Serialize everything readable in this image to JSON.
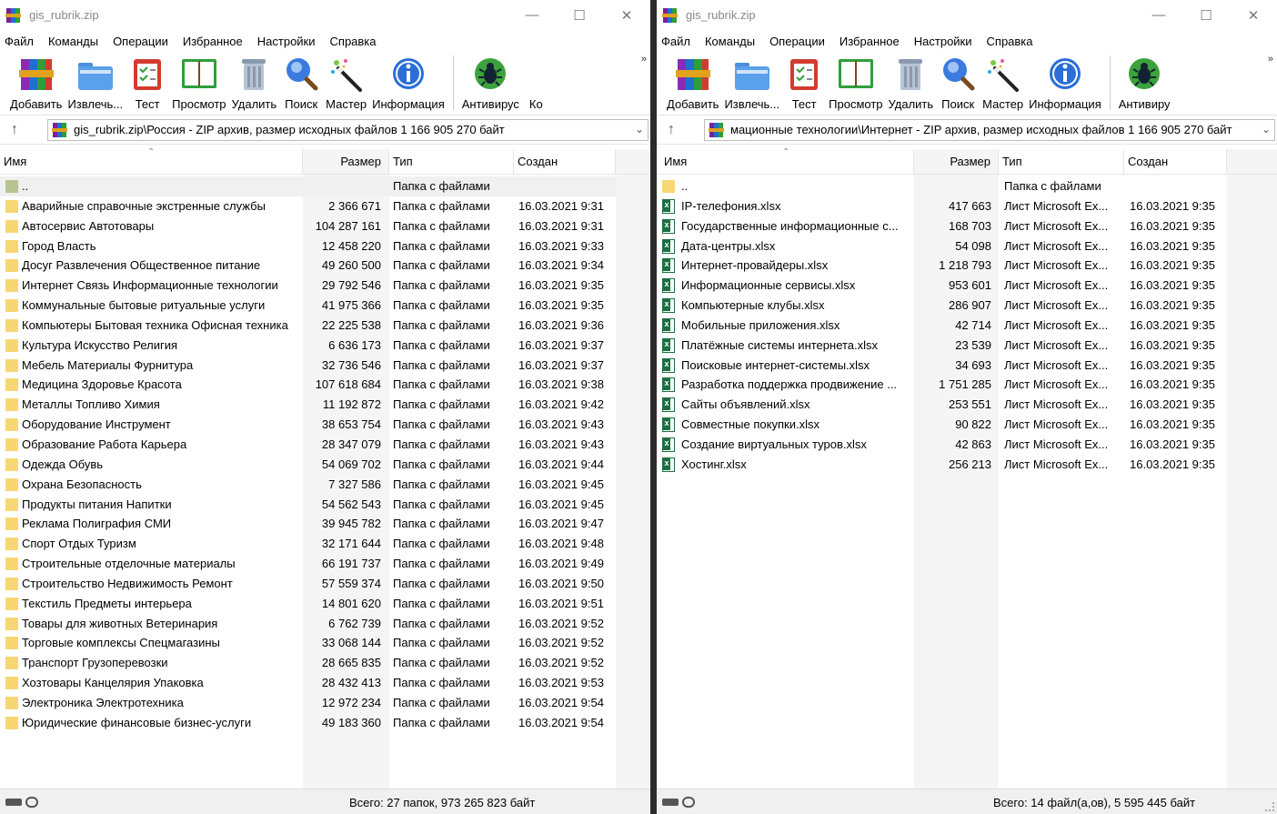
{
  "colors": {
    "folder": "#f7d774",
    "excel": "#1d6f42",
    "accent": "#0a5bd6"
  },
  "left": {
    "title": "gis_rubrik.zip",
    "menu": [
      "Файл",
      "Команды",
      "Операции",
      "Избранное",
      "Настройки",
      "Справка"
    ],
    "toolbar": [
      {
        "label": "Добавить",
        "icon": "books-icon"
      },
      {
        "label": "Извлечь...",
        "icon": "folder-extract-icon"
      },
      {
        "label": "Тест",
        "icon": "test-clipboard-icon"
      },
      {
        "label": "Просмотр",
        "icon": "book-view-icon"
      },
      {
        "label": "Удалить",
        "icon": "trash-icon"
      },
      {
        "label": "Поиск",
        "icon": "magnifier-icon"
      },
      {
        "label": "Мастер",
        "icon": "wand-icon"
      },
      {
        "label": "Информация",
        "icon": "info-icon"
      },
      {
        "label": "Антивирус",
        "icon": "bug-icon"
      },
      {
        "label": "Ко",
        "icon": ""
      }
    ],
    "address": "gis_rubrik.zip\\Россия - ZIP архив, размер исходных файлов 1 166 905 270 байт",
    "columns": {
      "name": "Имя",
      "size": "Размер",
      "type": "Тип",
      "created": "Создан"
    },
    "parent": {
      "name": "..",
      "type": "Папка с файлами"
    },
    "rows": [
      {
        "name": "Аварийные справочные экстренные службы",
        "size": "2 366 671",
        "type": "Папка с файлами",
        "created": "16.03.2021 9:31"
      },
      {
        "name": "Автосервис Автотовары",
        "size": "104 287 161",
        "type": "Папка с файлами",
        "created": "16.03.2021 9:31"
      },
      {
        "name": "Город Власть",
        "size": "12 458 220",
        "type": "Папка с файлами",
        "created": "16.03.2021 9:33"
      },
      {
        "name": "Досуг Развлечения Общественное питание",
        "size": "49 260 500",
        "type": "Папка с файлами",
        "created": "16.03.2021 9:34"
      },
      {
        "name": "Интернет Связь Информационные технологии",
        "size": "29 792 546",
        "type": "Папка с файлами",
        "created": "16.03.2021 9:35"
      },
      {
        "name": "Коммунальные бытовые ритуальные услуги",
        "size": "41 975 366",
        "type": "Папка с файлами",
        "created": "16.03.2021 9:35"
      },
      {
        "name": "Компьютеры Бытовая техника Офисная техника",
        "size": "22 225 538",
        "type": "Папка с файлами",
        "created": "16.03.2021 9:36"
      },
      {
        "name": "Культура Искусство Религия",
        "size": "6 636 173",
        "type": "Папка с файлами",
        "created": "16.03.2021 9:37"
      },
      {
        "name": "Мебель Материалы Фурнитура",
        "size": "32 736 546",
        "type": "Папка с файлами",
        "created": "16.03.2021 9:37"
      },
      {
        "name": "Медицина Здоровье Красота",
        "size": "107 618 684",
        "type": "Папка с файлами",
        "created": "16.03.2021 9:38"
      },
      {
        "name": "Металлы Топливо Химия",
        "size": "11 192 872",
        "type": "Папка с файлами",
        "created": "16.03.2021 9:42"
      },
      {
        "name": "Оборудование Инструмент",
        "size": "38 653 754",
        "type": "Папка с файлами",
        "created": "16.03.2021 9:43"
      },
      {
        "name": "Образование Работа Карьера",
        "size": "28 347 079",
        "type": "Папка с файлами",
        "created": "16.03.2021 9:43"
      },
      {
        "name": "Одежда Обувь",
        "size": "54 069 702",
        "type": "Папка с файлами",
        "created": "16.03.2021 9:44"
      },
      {
        "name": "Охрана Безопасность",
        "size": "7 327 586",
        "type": "Папка с файлами",
        "created": "16.03.2021 9:45"
      },
      {
        "name": "Продукты питания Напитки",
        "size": "54 562 543",
        "type": "Папка с файлами",
        "created": "16.03.2021 9:45"
      },
      {
        "name": "Реклама Полиграфия СМИ",
        "size": "39 945 782",
        "type": "Папка с файлами",
        "created": "16.03.2021 9:47"
      },
      {
        "name": "Спорт Отдых Туризм",
        "size": "32 171 644",
        "type": "Папка с файлами",
        "created": "16.03.2021 9:48"
      },
      {
        "name": "Строительные отделочные материалы",
        "size": "66 191 737",
        "type": "Папка с файлами",
        "created": "16.03.2021 9:49"
      },
      {
        "name": "Строительство Недвижимость Ремонт",
        "size": "57 559 374",
        "type": "Папка с файлами",
        "created": "16.03.2021 9:50"
      },
      {
        "name": "Текстиль Предметы интерьера",
        "size": "14 801 620",
        "type": "Папка с файлами",
        "created": "16.03.2021 9:51"
      },
      {
        "name": "Товары для животных Ветеринария",
        "size": "6 762 739",
        "type": "Папка с файлами",
        "created": "16.03.2021 9:52"
      },
      {
        "name": "Торговые комплексы Спецмагазины",
        "size": "33 068 144",
        "type": "Папка с файлами",
        "created": "16.03.2021 9:52"
      },
      {
        "name": "Транспорт Грузоперевозки",
        "size": "28 665 835",
        "type": "Папка с файлами",
        "created": "16.03.2021 9:52"
      },
      {
        "name": "Хозтовары Канцелярия Упаковка",
        "size": "28 432 413",
        "type": "Папка с файлами",
        "created": "16.03.2021 9:53"
      },
      {
        "name": "Электроника Электротехника",
        "size": "12 972 234",
        "type": "Папка с файлами",
        "created": "16.03.2021 9:54"
      },
      {
        "name": "Юридические финансовые бизнес-услуги",
        "size": "49 183 360",
        "type": "Папка с файлами",
        "created": "16.03.2021 9:54"
      }
    ],
    "status": "Всего: 27 папок, 973 265 823 байт"
  },
  "right": {
    "title": "gis_rubrik.zip",
    "menu": [
      "Файл",
      "Команды",
      "Операции",
      "Избранное",
      "Настройки",
      "Справка"
    ],
    "toolbar": [
      {
        "label": "Добавить",
        "icon": "books-icon"
      },
      {
        "label": "Извлечь...",
        "icon": "folder-extract-icon"
      },
      {
        "label": "Тест",
        "icon": "test-clipboard-icon"
      },
      {
        "label": "Просмотр",
        "icon": "book-view-icon"
      },
      {
        "label": "Удалить",
        "icon": "trash-icon"
      },
      {
        "label": "Поиск",
        "icon": "magnifier-icon"
      },
      {
        "label": "Мастер",
        "icon": "wand-icon"
      },
      {
        "label": "Информация",
        "icon": "info-icon"
      },
      {
        "label": "Антивиру",
        "icon": "bug-icon"
      }
    ],
    "address": "мационные технологии\\Интернет - ZIP архив, размер исходных файлов 1 166 905 270 байт",
    "columns": {
      "name": "Имя",
      "size": "Размер",
      "type": "Тип",
      "created": "Создан"
    },
    "parent": {
      "name": "..",
      "type": "Папка с файлами"
    },
    "rows": [
      {
        "name": "IP-телефония.xlsx",
        "size": "417 663",
        "type": "Лист Microsoft Ex...",
        "created": "16.03.2021 9:35"
      },
      {
        "name": "Государственные информационные с...",
        "size": "168 703",
        "type": "Лист Microsoft Ex...",
        "created": "16.03.2021 9:35"
      },
      {
        "name": "Дата-центры.xlsx",
        "size": "54 098",
        "type": "Лист Microsoft Ex...",
        "created": "16.03.2021 9:35"
      },
      {
        "name": "Интернет-провайдеры.xlsx",
        "size": "1 218 793",
        "type": "Лист Microsoft Ex...",
        "created": "16.03.2021 9:35"
      },
      {
        "name": "Информационные сервисы.xlsx",
        "size": "953 601",
        "type": "Лист Microsoft Ex...",
        "created": "16.03.2021 9:35"
      },
      {
        "name": "Компьютерные клубы.xlsx",
        "size": "286 907",
        "type": "Лист Microsoft Ex...",
        "created": "16.03.2021 9:35"
      },
      {
        "name": "Мобильные приложения.xlsx",
        "size": "42 714",
        "type": "Лист Microsoft Ex...",
        "created": "16.03.2021 9:35"
      },
      {
        "name": "Платёжные системы интернета.xlsx",
        "size": "23 539",
        "type": "Лист Microsoft Ex...",
        "created": "16.03.2021 9:35"
      },
      {
        "name": "Поисковые интернет-системы.xlsx",
        "size": "34 693",
        "type": "Лист Microsoft Ex...",
        "created": "16.03.2021 9:35"
      },
      {
        "name": "Разработка поддержка продвижение ...",
        "size": "1 751 285",
        "type": "Лист Microsoft Ex...",
        "created": "16.03.2021 9:35"
      },
      {
        "name": "Сайты объявлений.xlsx",
        "size": "253 551",
        "type": "Лист Microsoft Ex...",
        "created": "16.03.2021 9:35"
      },
      {
        "name": "Совместные покупки.xlsx",
        "size": "90 822",
        "type": "Лист Microsoft Ex...",
        "created": "16.03.2021 9:35"
      },
      {
        "name": "Создание виртуальных туров.xlsx",
        "size": "42 863",
        "type": "Лист Microsoft Ex...",
        "created": "16.03.2021 9:35"
      },
      {
        "name": "Хостинг.xlsx",
        "size": "256 213",
        "type": "Лист Microsoft Ex...",
        "created": "16.03.2021 9:35"
      }
    ],
    "status": "Всего: 14 файл(а,ов), 5 595 445 байт"
  }
}
